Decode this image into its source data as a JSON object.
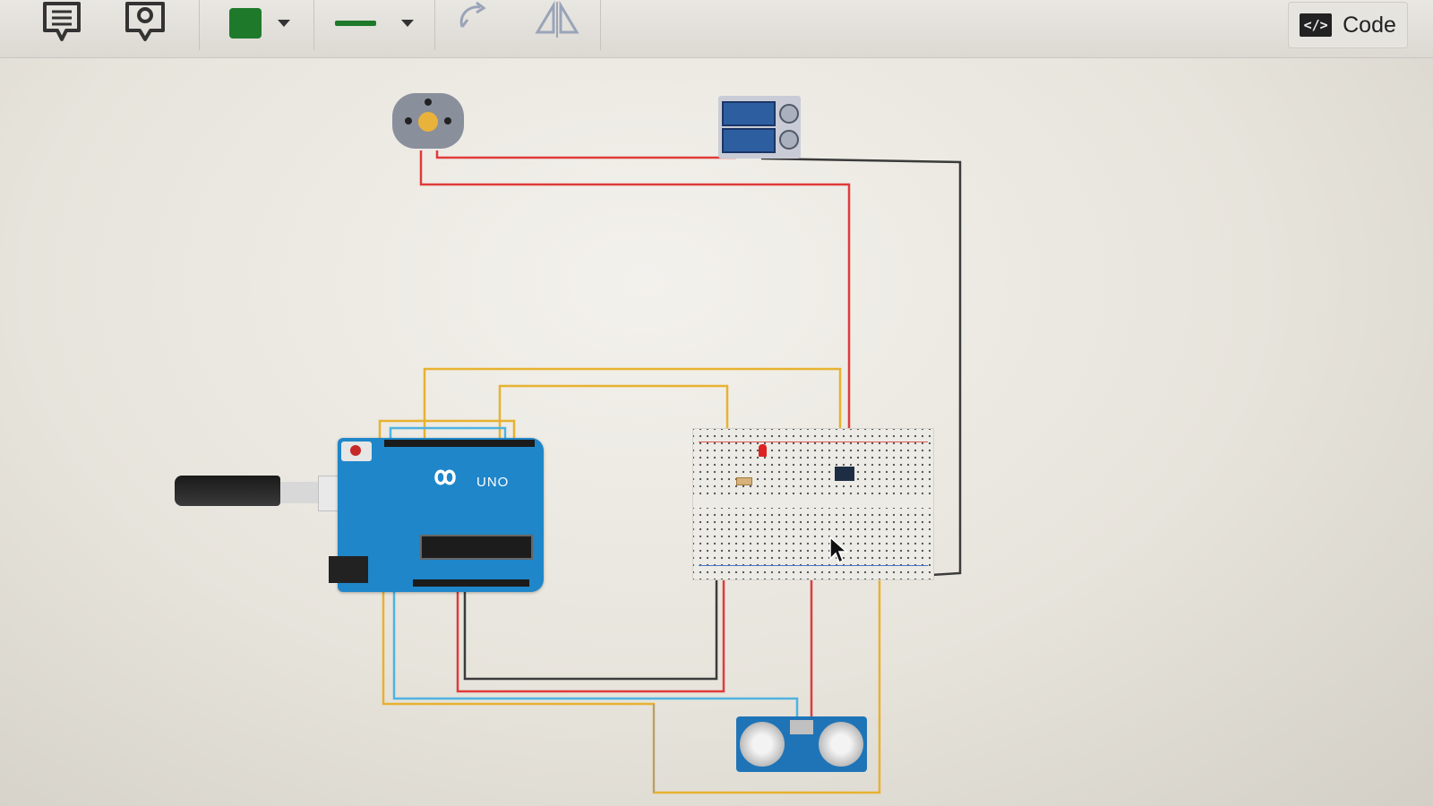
{
  "toolbar": {
    "icons": [
      "notes-icon",
      "inspect-icon",
      "color-picker",
      "wire-style",
      "rotate-icon",
      "flip-icon"
    ],
    "wire_color": "#1e7a2a",
    "code_button_label": "Code"
  },
  "canvas": {
    "components": [
      "dc-motor",
      "battery-pack",
      "arduino-uno",
      "usb-cable",
      "breadboard",
      "led",
      "resistor",
      "ic-chip",
      "ultrasonic-sensor"
    ],
    "arduino_label": "UNO",
    "wire_colors": {
      "red": "#e03b3b",
      "black": "#3b3b3b",
      "yellow": "#e7b230",
      "blue": "#4fb3e0"
    }
  }
}
